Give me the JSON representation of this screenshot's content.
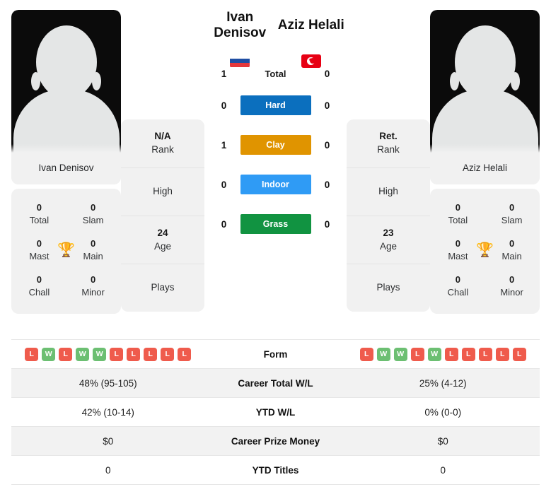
{
  "players": {
    "left": {
      "name": "Ivan Denisov",
      "photo_label": "Ivan Denisov",
      "flag": "russia-flag",
      "titles": {
        "total_value": "0",
        "total_label": "Total",
        "slam_value": "0",
        "slam_label": "Slam",
        "mast_value": "0",
        "mast_label": "Mast",
        "main_value": "0",
        "main_label": "Main",
        "chall_value": "0",
        "chall_label": "Chall",
        "minor_value": "0",
        "minor_label": "Minor",
        "trophy_icon": "trophy-icon"
      },
      "info": {
        "rank_value": "N/A",
        "rank_label": "Rank",
        "high_label": "High",
        "age_value": "24",
        "age_label": "Age",
        "plays_label": "Plays"
      },
      "form": [
        "L",
        "W",
        "L",
        "W",
        "W",
        "L",
        "L",
        "L",
        "L",
        "L"
      ],
      "career_wl": "48% (95-105)",
      "ytd_wl": "42% (10-14)",
      "career_prize": "$0",
      "ytd_titles": "0"
    },
    "right": {
      "name": "Aziz Helali",
      "photo_label": "Aziz Helali",
      "flag": "tunisia-flag",
      "titles": {
        "total_value": "0",
        "total_label": "Total",
        "slam_value": "0",
        "slam_label": "Slam",
        "mast_value": "0",
        "mast_label": "Mast",
        "main_value": "0",
        "main_label": "Main",
        "chall_value": "0",
        "chall_label": "Chall",
        "minor_value": "0",
        "minor_label": "Minor",
        "trophy_icon": "trophy-icon"
      },
      "info": {
        "rank_value": "Ret.",
        "rank_label": "Rank",
        "high_label": "High",
        "age_value": "23",
        "age_label": "Age",
        "plays_label": "Plays"
      },
      "form": [
        "L",
        "W",
        "W",
        "L",
        "W",
        "L",
        "L",
        "L",
        "L",
        "L"
      ],
      "career_wl": "25% (4-12)",
      "ytd_wl": "0% (0-0)",
      "career_prize": "$0",
      "ytd_titles": "0"
    }
  },
  "head_to_head": {
    "rows": [
      {
        "label": "Total",
        "left": "1",
        "right": "0",
        "badge": false,
        "color": ""
      },
      {
        "label": "Hard",
        "left": "0",
        "right": "0",
        "badge": true,
        "color": "#0b6fbe"
      },
      {
        "label": "Clay",
        "left": "1",
        "right": "0",
        "badge": true,
        "color": "#e09400"
      },
      {
        "label": "Indoor",
        "left": "0",
        "right": "0",
        "badge": true,
        "color": "#2f9bf5"
      },
      {
        "label": "Grass",
        "left": "0",
        "right": "0",
        "badge": true,
        "color": "#119341"
      }
    ]
  },
  "comparison_table": {
    "rows": [
      {
        "label": "Form",
        "type": "form",
        "shaded": false
      },
      {
        "label": "Career Total W/L",
        "type": "text",
        "shaded": true,
        "key": "career_wl"
      },
      {
        "label": "YTD W/L",
        "type": "text",
        "shaded": false,
        "key": "ytd_wl"
      },
      {
        "label": "Career Prize Money",
        "type": "text",
        "shaded": true,
        "key": "career_prize"
      },
      {
        "label": "YTD Titles",
        "type": "text",
        "shaded": false,
        "key": "ytd_titles"
      }
    ]
  },
  "colors": {
    "hard": "#0b6fbe",
    "clay": "#e09400",
    "indoor": "#2f9bf5",
    "grass": "#119341",
    "win": "#6cbf72",
    "loss": "#ef5b4c",
    "trophy": "#3f72be"
  }
}
